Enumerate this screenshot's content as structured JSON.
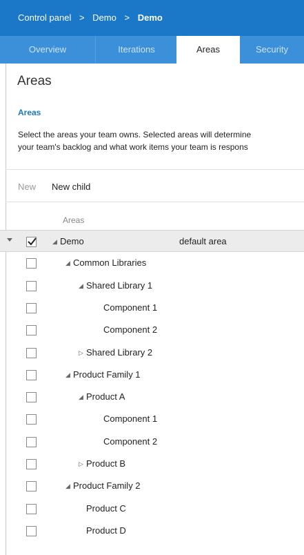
{
  "breadcrumb": {
    "items": [
      "Control panel",
      "Demo"
    ],
    "current": "Demo",
    "separator": ">"
  },
  "tabs": [
    {
      "label": "Overview"
    },
    {
      "label": "Iterations"
    },
    {
      "label": "Areas"
    },
    {
      "label": "Security"
    }
  ],
  "page": {
    "title": "Areas",
    "section_title": "Areas",
    "description_line1": "Select the areas your team owns. Selected areas will determine",
    "description_line2": "your team's backlog and what work items your team is respons"
  },
  "toolbar": {
    "new_label": "New",
    "new_child_label": "New child"
  },
  "tree": {
    "column_header": "Areas",
    "rows": [
      {
        "label": "Demo",
        "extra": "default area",
        "checked": true
      },
      {
        "label": "Common Libraries",
        "checked": false
      },
      {
        "label": "Shared Library 1",
        "checked": false
      },
      {
        "label": "Component 1",
        "checked": false
      },
      {
        "label": "Component 2",
        "checked": false
      },
      {
        "label": "Shared Library 2",
        "checked": false
      },
      {
        "label": "Product Family 1",
        "checked": false
      },
      {
        "label": "Product A",
        "checked": false
      },
      {
        "label": "Component 1",
        "checked": false
      },
      {
        "label": "Component 2",
        "checked": false
      },
      {
        "label": "Product B",
        "checked": false
      },
      {
        "label": "Product Family 2",
        "checked": false
      },
      {
        "label": "Product C",
        "checked": false
      },
      {
        "label": "Product D",
        "checked": false
      }
    ]
  },
  "colors": {
    "header_bar": "#1b78c9",
    "tab_bar": "#3c90da",
    "accent": "#1b78c9"
  }
}
